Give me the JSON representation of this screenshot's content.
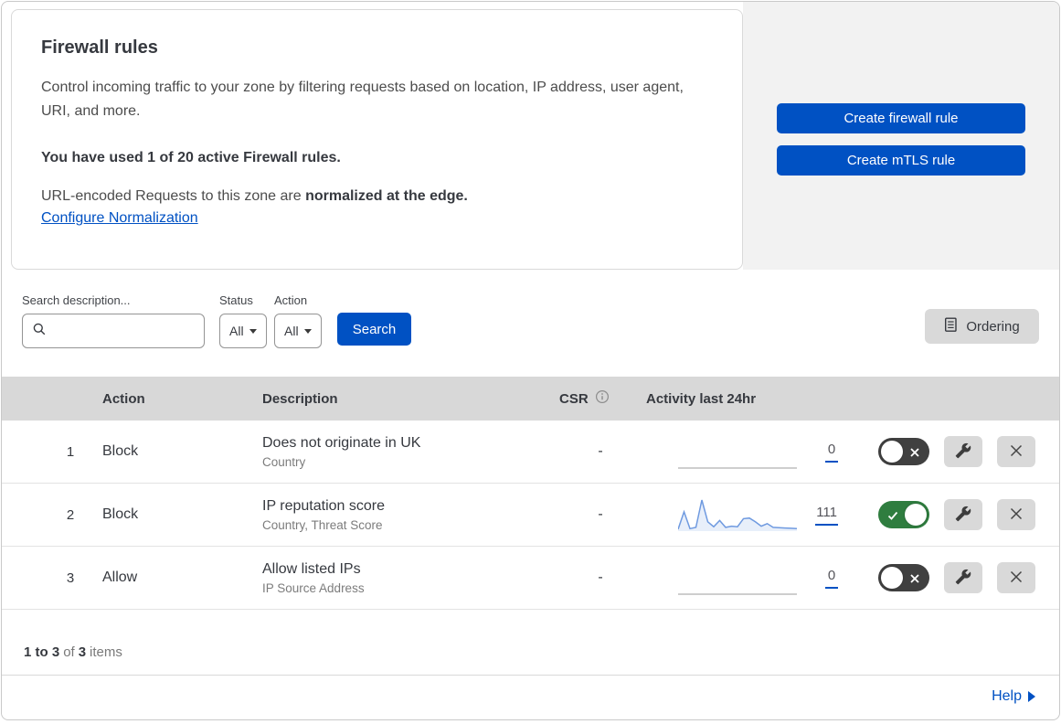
{
  "colors": {
    "primary_blue": "#0051c3",
    "toggle_on_green": "#2f7d3f",
    "toggle_off_gray": "#404040",
    "sparkline_blue": "#6f9ae0",
    "panel_gray": "#f2f2f2",
    "table_header_gray": "#d8d8d8"
  },
  "header": {
    "title": "Firewall rules",
    "description": "Control incoming traffic to your zone by filtering requests based on location, IP address, user agent, URI, and more.",
    "usage_text": "You have used 1 of 20 active Firewall rules.",
    "normalization_text": "URL-encoded Requests to this zone are",
    "normalization_bold": "normalized at the edge.",
    "normalization_link": "Configure Normalization",
    "create_firewall_button": "Create firewall rule",
    "create_mtls_button": "Create mTLS rule"
  },
  "filters": {
    "search_label": "Search description...",
    "search_value": "",
    "status_label": "Status",
    "status_value": "All",
    "action_label": "Action",
    "action_value": "All",
    "search_button": "Search",
    "ordering_button": "Ordering"
  },
  "table": {
    "headers": {
      "action": "Action",
      "description": "Description",
      "csr": "CSR",
      "activity": "Activity last 24hr"
    },
    "rows": [
      {
        "number": "1",
        "action": "Block",
        "description": "Does not originate in UK",
        "criteria": "Country",
        "csr": "-",
        "activity_count": "0",
        "enabled": false,
        "sparkline": []
      },
      {
        "number": "2",
        "action": "Block",
        "description": "IP reputation score",
        "criteria": "Country, Threat Score",
        "csr": "-",
        "activity_count": "111",
        "enabled": true,
        "sparkline": [
          6,
          62,
          8,
          12,
          100,
          30,
          14,
          34,
          12,
          16,
          14,
          40,
          42,
          30,
          16,
          24,
          12,
          11,
          10,
          9,
          8
        ]
      },
      {
        "number": "3",
        "action": "Allow",
        "description": "Allow listed IPs",
        "criteria": "IP Source Address",
        "csr": "-",
        "activity_count": "0",
        "enabled": false,
        "sparkline": []
      }
    ]
  },
  "footer": {
    "range": "1 to 3",
    "of": "of",
    "total": "3",
    "items": "items"
  },
  "help": {
    "label": "Help"
  }
}
